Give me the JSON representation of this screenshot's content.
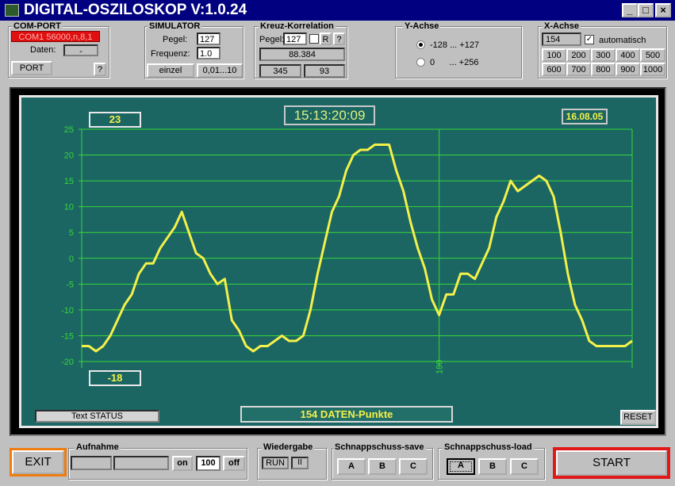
{
  "window": {
    "title": "DIGITAL-OSZILOSKOP V:1.0.24",
    "min_symbol": "_",
    "max_symbol": "□",
    "close_symbol": "×"
  },
  "com_port": {
    "label": "COM-PORT",
    "port_value": "COM1 56000,n,8,1",
    "daten_label": "Daten:",
    "daten_value": "-",
    "port_button": "PORT",
    "help_button": "?"
  },
  "simulator": {
    "label": "SIMULATOR",
    "pegel_label": "Pegel:",
    "pegel_value": "127",
    "frequenz_label": "Frequenz:",
    "frequenz_value": "1.0",
    "einzel_button": "einzel",
    "range_button": "0,01...10"
  },
  "kreuz": {
    "label": "Kreuz-Korrelation",
    "pegel_label": "Pegel:",
    "pegel_value": "127",
    "r_button": "R",
    "help_button": "?",
    "result": "88.384",
    "val_left": "345",
    "val_right": "93"
  },
  "y_achse": {
    "label": "Y-Achse",
    "option1": "-128 ... +127",
    "option2": "0      ... +256",
    "selected": 0
  },
  "x_achse": {
    "label": "X-Achse",
    "value": "154",
    "auto_label": "automatisch",
    "auto_checked": true,
    "presets_row1": [
      "100",
      "200",
      "300",
      "400",
      "500"
    ],
    "presets_row2": [
      "600",
      "700",
      "800",
      "900",
      "1000"
    ]
  },
  "display": {
    "max_value": "23",
    "min_value": "-18",
    "time": "15:13:20:09",
    "date": "16.08.05",
    "status": "Text STATUS",
    "points_label": "154 DATEN-Punkte",
    "reset_button": "RESET",
    "cursor_label": "100",
    "trace_color": "#f4f04a",
    "grid_color": "#37d637",
    "bg_color": "#1b6663"
  },
  "chart_data": {
    "type": "line",
    "y_ticks": [
      "25",
      "20",
      "15",
      "10",
      "5",
      "0",
      "-5",
      "-10",
      "-15",
      "-20"
    ],
    "ylim": [
      -20,
      25
    ],
    "xlim": [
      0,
      154
    ],
    "cursor_x": 100,
    "series": [
      {
        "x": [
          0,
          2,
          4,
          6,
          8,
          10,
          12,
          14,
          16,
          18,
          20,
          22,
          24,
          26,
          28,
          30,
          32,
          34,
          36,
          38,
          40,
          42,
          44,
          46,
          48,
          50,
          52,
          54,
          56,
          58,
          60,
          62,
          64,
          66,
          68,
          70,
          72,
          74,
          76,
          78,
          80,
          82,
          84,
          86,
          88,
          90,
          92,
          94,
          96,
          98,
          100,
          102,
          104,
          106,
          108,
          110,
          112,
          114,
          116,
          118,
          120,
          122,
          124,
          126,
          128,
          130,
          132,
          134,
          136,
          138,
          140,
          142,
          144,
          146,
          148,
          150,
          152,
          154
        ],
        "values": [
          -17,
          -17,
          -18,
          -17,
          -15,
          -12,
          -9,
          -7,
          -3,
          -1,
          -1,
          2,
          4,
          6,
          9,
          5,
          1,
          0,
          -3,
          -5,
          -4,
          -12,
          -14,
          -17,
          -18,
          -17,
          -17,
          -16,
          -15,
          -16,
          -16,
          -15,
          -10,
          -3,
          3,
          9,
          12,
          17,
          20,
          21,
          21,
          22,
          22,
          22,
          17,
          13,
          7,
          2,
          -2,
          -8,
          -11,
          -7,
          -7,
          -3,
          -3,
          -4,
          -1,
          2,
          8,
          11,
          15,
          13,
          14,
          15,
          16,
          15,
          12,
          5,
          -3,
          -9,
          -12,
          -16,
          -17,
          -17,
          -17,
          -17,
          -17,
          -16
        ]
      }
    ]
  },
  "bottom": {
    "exit_button": "EXIT",
    "aufnahme_label": "Aufnahme",
    "on_button": "on",
    "count_value": "100",
    "off_button": "off",
    "wiedergabe_label": "Wiedergabe",
    "run_button": "RUN",
    "pause_button": "II",
    "save_label": "Schnappschuss-save",
    "save_buttons": [
      "A",
      "B",
      "C"
    ],
    "load_label": "Schnappschuss-load",
    "load_buttons": [
      "A",
      "B",
      "C"
    ],
    "start_button": "START"
  }
}
